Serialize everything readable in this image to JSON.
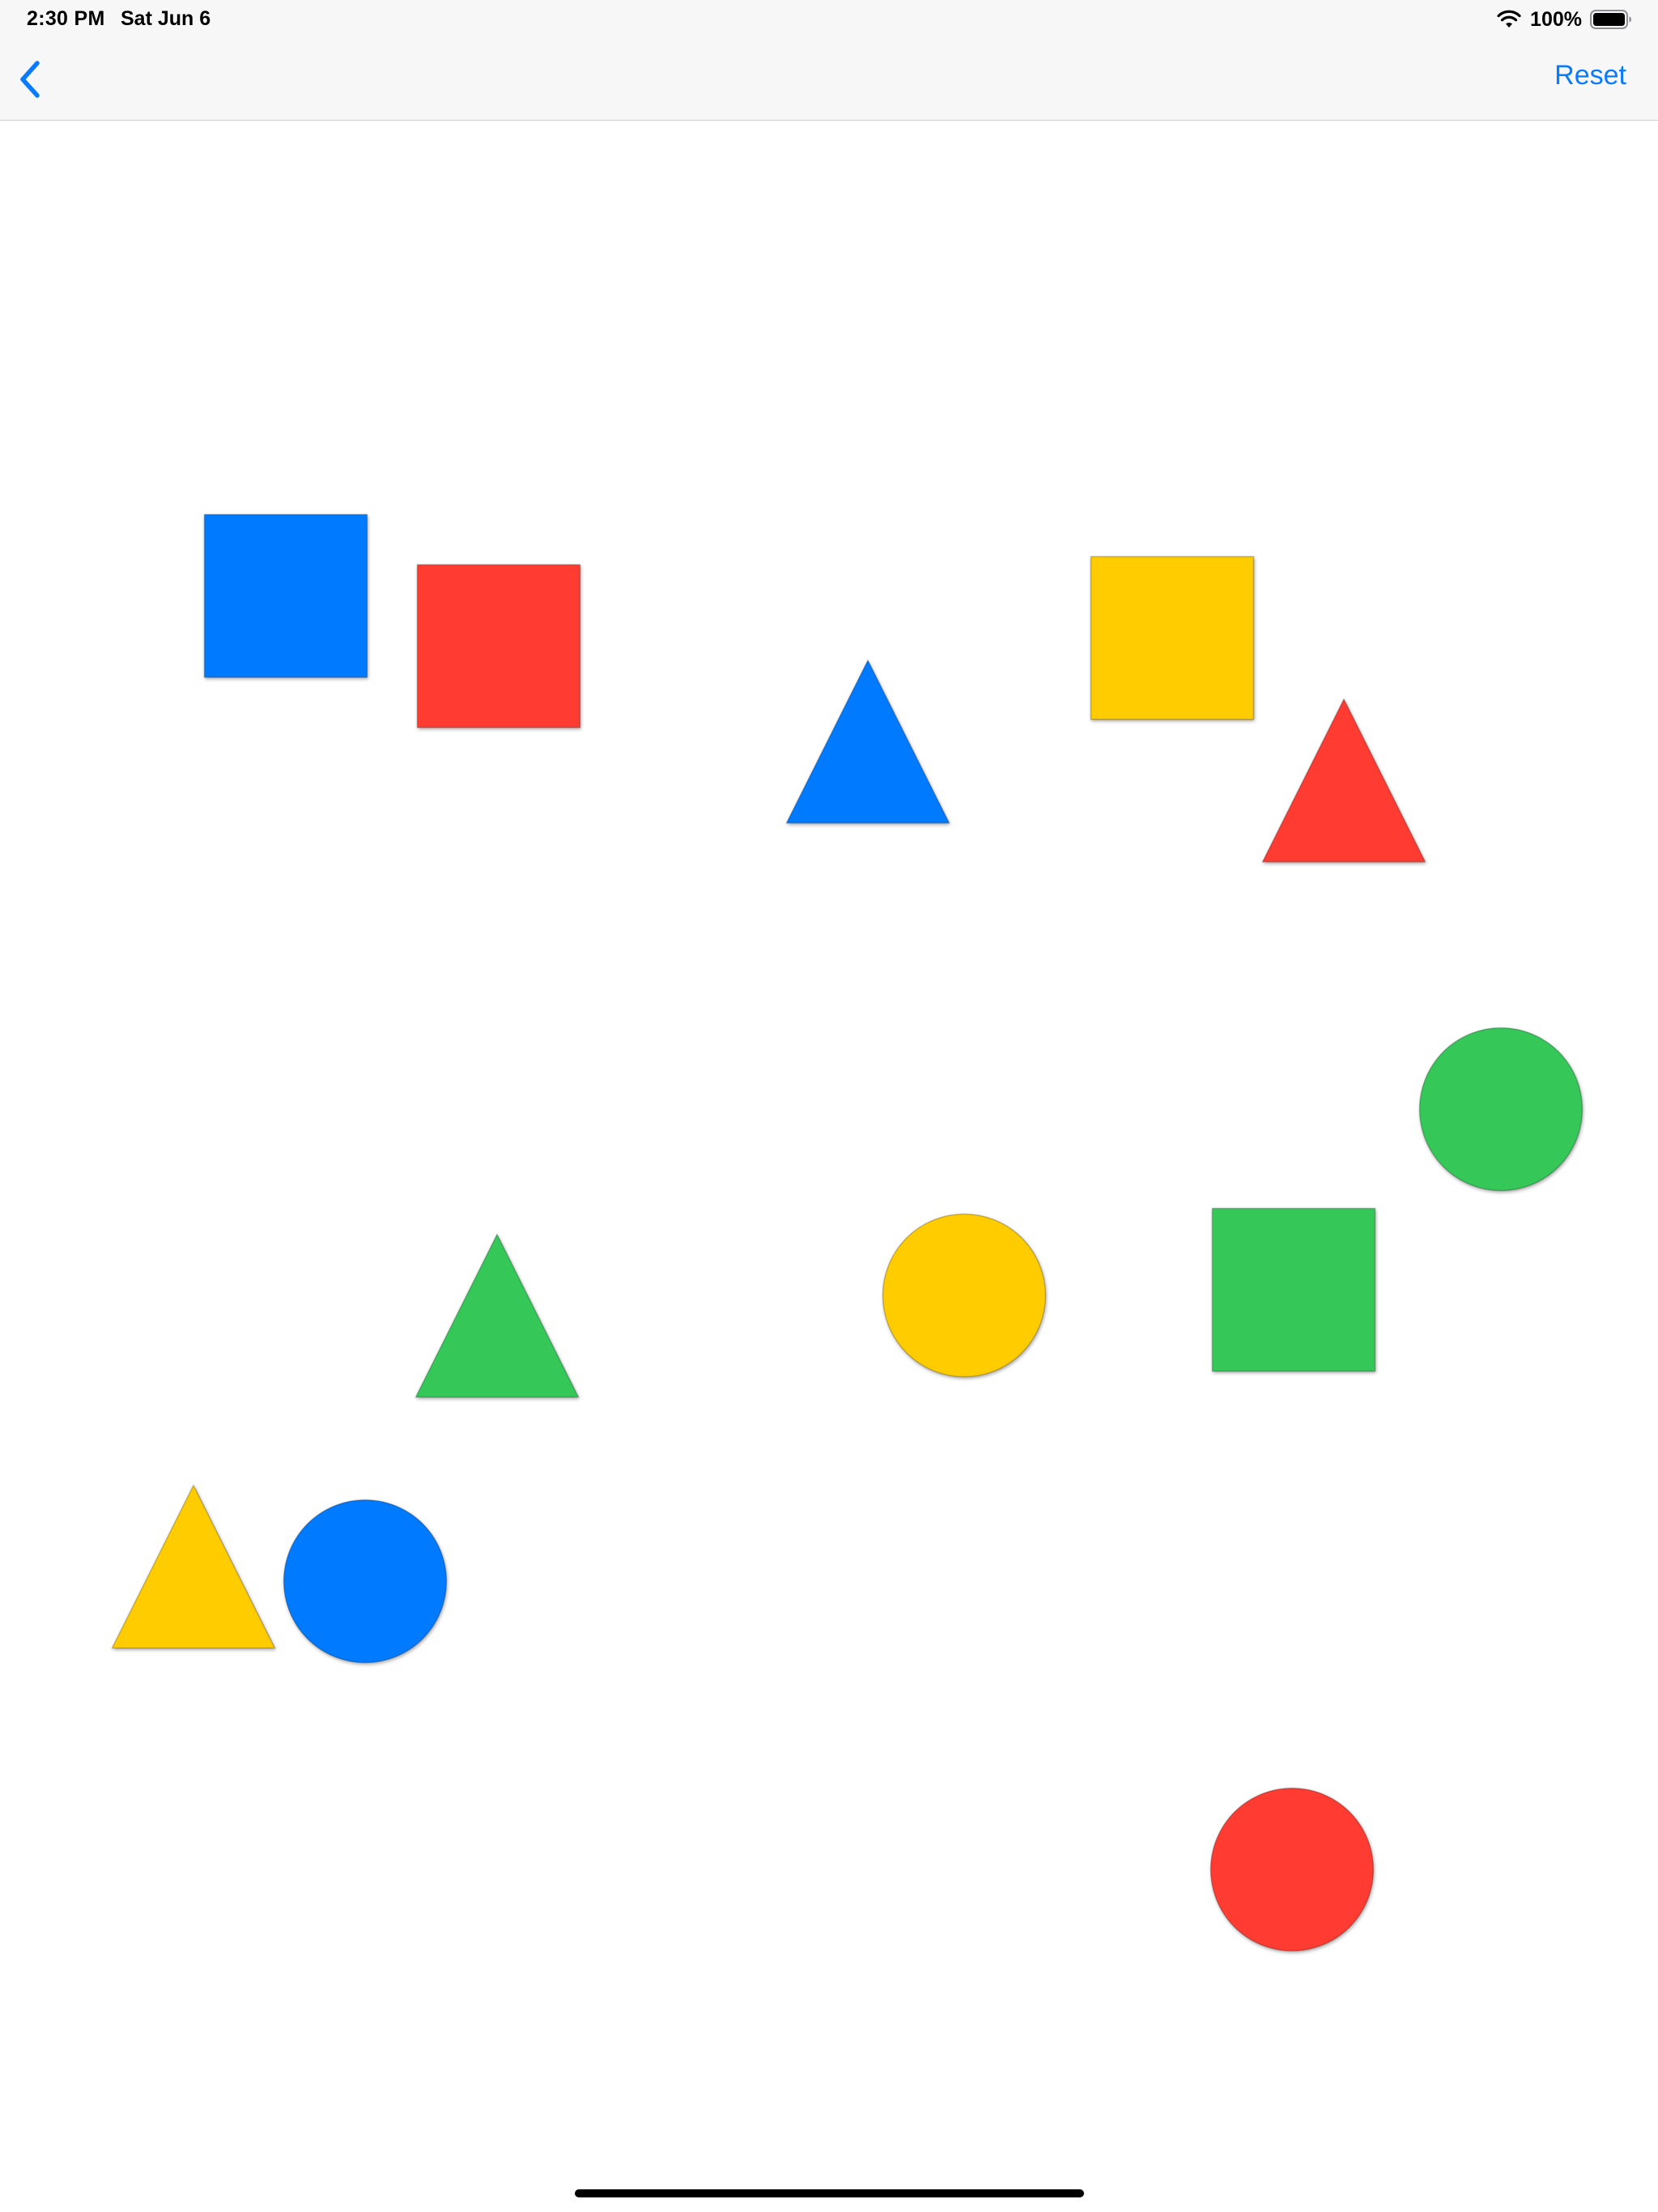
{
  "status_bar": {
    "time": "2:30 PM",
    "date": "Sat Jun 6",
    "battery_percent": "100%",
    "icons": [
      "wifi-icon",
      "battery-icon"
    ]
  },
  "nav_bar": {
    "back_icon": "chevron-left-icon",
    "reset_label": "Reset",
    "accent_color": "#0a7aff"
  },
  "palette": {
    "blue": "#007aff",
    "red": "#ff3b30",
    "yellow": "#ffcc00",
    "green": "#34c759"
  },
  "shapes": [
    {
      "kind": "square",
      "color": "blue"
    },
    {
      "kind": "square",
      "color": "red"
    },
    {
      "kind": "triangle",
      "color": "blue"
    },
    {
      "kind": "square",
      "color": "yellow"
    },
    {
      "kind": "triangle",
      "color": "red"
    },
    {
      "kind": "circle",
      "color": "green"
    },
    {
      "kind": "triangle",
      "color": "green"
    },
    {
      "kind": "circle",
      "color": "yellow"
    },
    {
      "kind": "square",
      "color": "green"
    },
    {
      "kind": "triangle",
      "color": "yellow"
    },
    {
      "kind": "circle",
      "color": "blue"
    },
    {
      "kind": "circle",
      "color": "red"
    }
  ]
}
